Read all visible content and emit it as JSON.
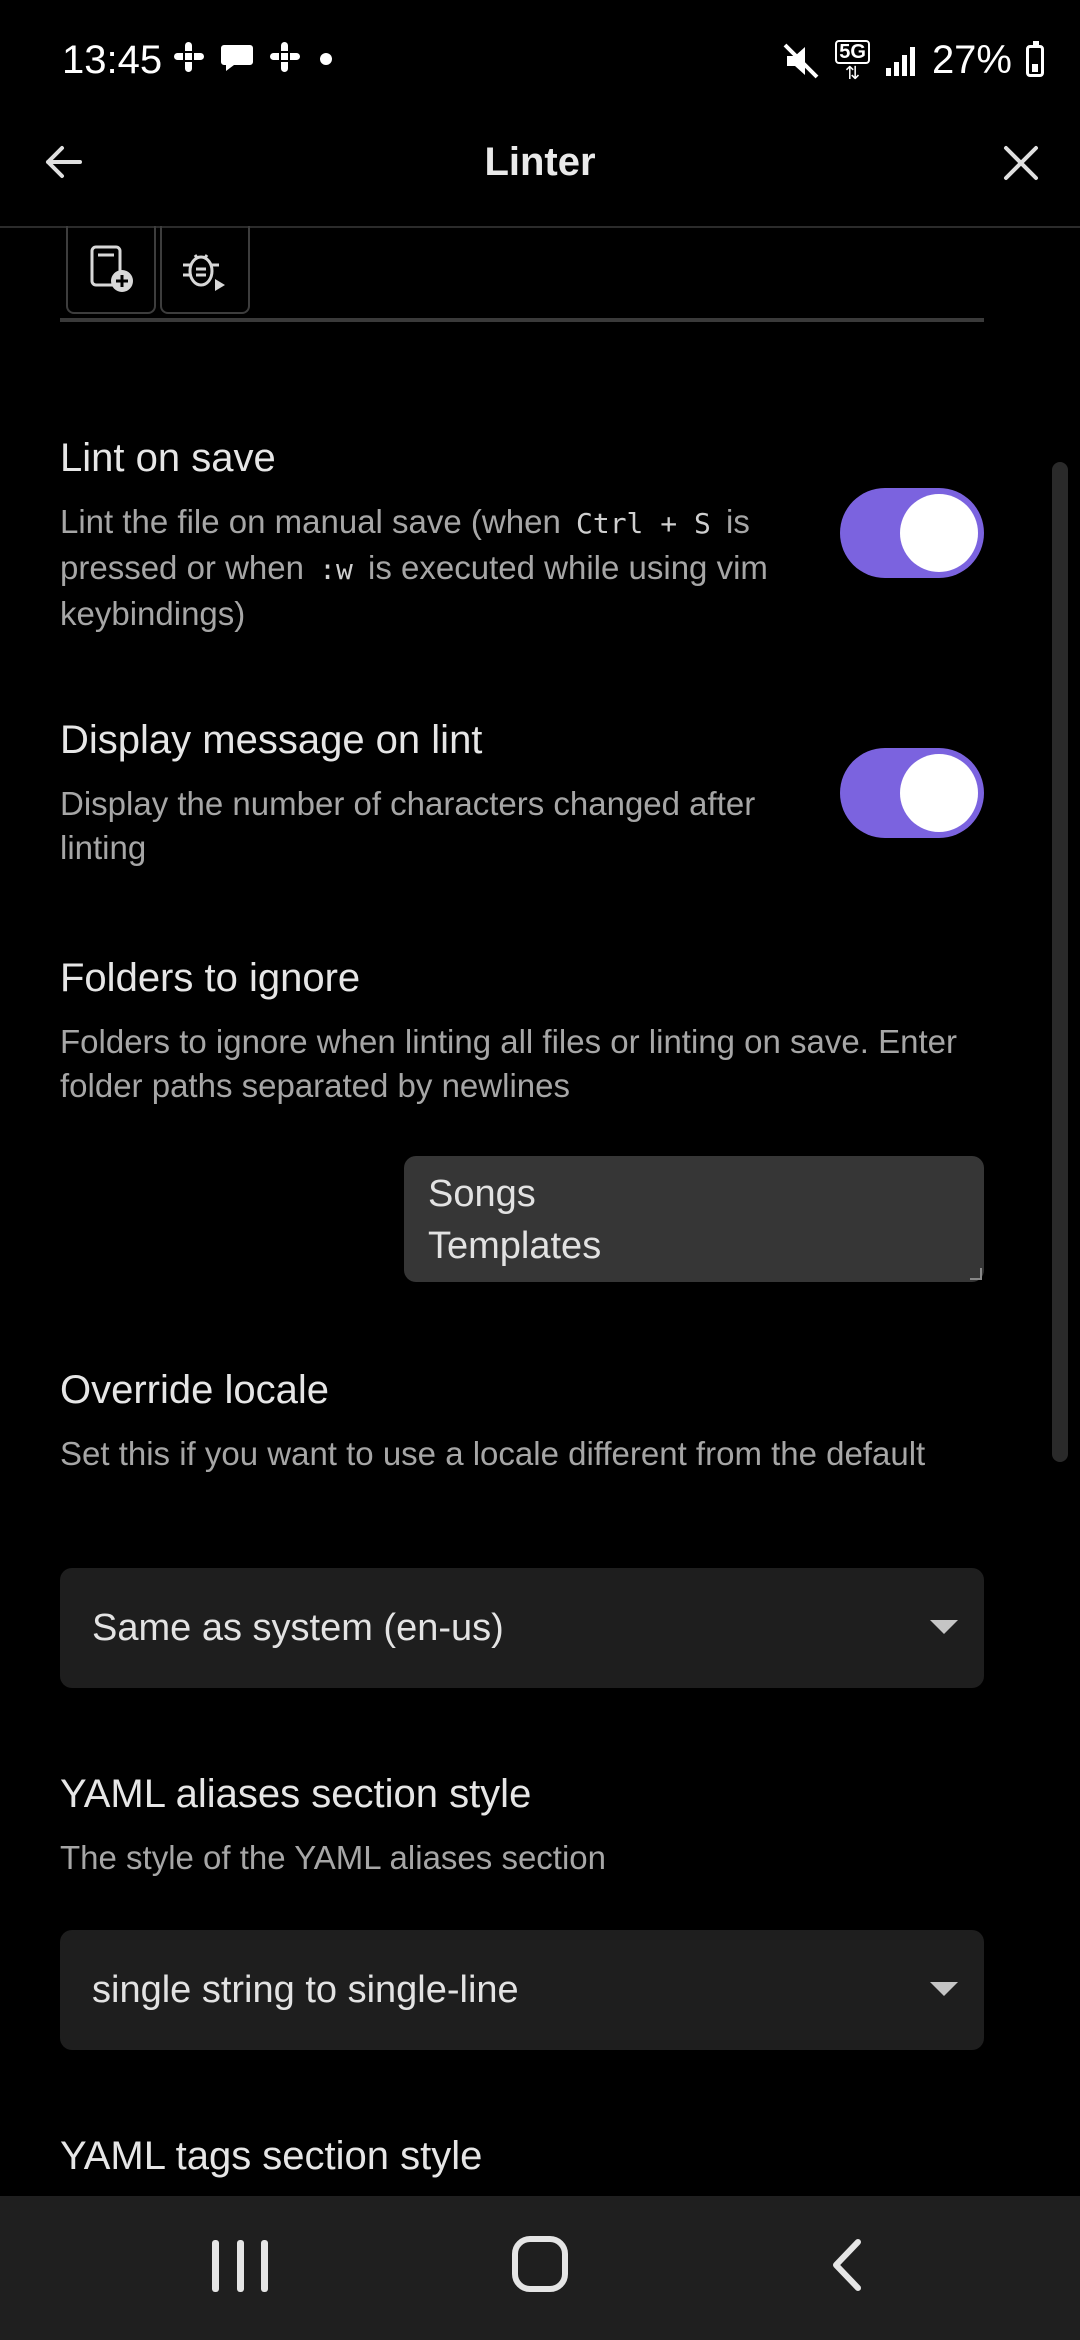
{
  "status_bar": {
    "time": "13:45",
    "left_icons": [
      "slack-icon",
      "chat-icon",
      "slack-icon",
      "dot-icon"
    ],
    "right_icons": [
      "mute-icon",
      "5g-icon",
      "signal-icon"
    ],
    "network_label": "5G",
    "battery": "27%"
  },
  "header": {
    "title": "Linter",
    "back_icon": "back-arrow-icon",
    "close_icon": "close-icon"
  },
  "tabs": [
    {
      "icon": "file-plus-icon"
    },
    {
      "icon": "bug-play-icon"
    }
  ],
  "settings": {
    "lint_on_save": {
      "title": "Lint on save",
      "desc_part1": "Lint the file on manual save (when",
      "key_combo": "Ctrl + S",
      "desc_part2": "is pressed or when",
      "vim_cmd": ":w",
      "desc_part3": "is executed while using vim keybindings)",
      "enabled": true
    },
    "display_message": {
      "title": "Display message on lint",
      "desc": "Display the number of characters changed after linting",
      "enabled": true
    },
    "folders_to_ignore": {
      "title": "Folders to ignore",
      "desc": "Folders to ignore when linting all files or linting on save. Enter folder paths separated by newlines",
      "values": [
        "Songs",
        "Templates"
      ]
    },
    "override_locale": {
      "title": "Override locale",
      "desc": "Set this if you want to use a locale different from the default",
      "selected": "Same as system (en-us)"
    },
    "yaml_aliases_style": {
      "title": "YAML aliases section style",
      "desc": "The style of the YAML aliases section",
      "selected": "single string to single-line"
    },
    "yaml_tags_style": {
      "title": "YAML tags section style"
    }
  },
  "colors": {
    "accent": "#7b63df",
    "background": "#000000"
  },
  "nav_bar": {
    "recents_icon": "recents-icon",
    "home_icon": "home-icon",
    "back_icon": "nav-back-icon"
  }
}
